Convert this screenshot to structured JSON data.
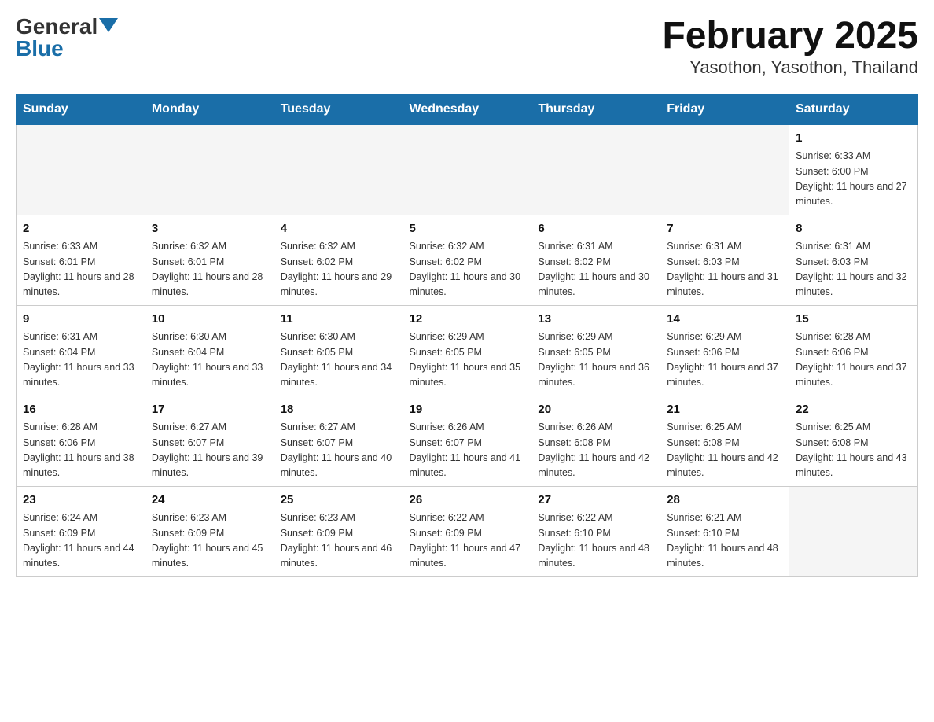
{
  "header": {
    "logo_general": "General",
    "logo_blue": "Blue",
    "title": "February 2025",
    "subtitle": "Yasothon, Yasothon, Thailand"
  },
  "days_of_week": [
    "Sunday",
    "Monday",
    "Tuesday",
    "Wednesday",
    "Thursday",
    "Friday",
    "Saturday"
  ],
  "weeks": [
    [
      {
        "day": "",
        "info": ""
      },
      {
        "day": "",
        "info": ""
      },
      {
        "day": "",
        "info": ""
      },
      {
        "day": "",
        "info": ""
      },
      {
        "day": "",
        "info": ""
      },
      {
        "day": "",
        "info": ""
      },
      {
        "day": "1",
        "info": "Sunrise: 6:33 AM\nSunset: 6:00 PM\nDaylight: 11 hours and 27 minutes."
      }
    ],
    [
      {
        "day": "2",
        "info": "Sunrise: 6:33 AM\nSunset: 6:01 PM\nDaylight: 11 hours and 28 minutes."
      },
      {
        "day": "3",
        "info": "Sunrise: 6:32 AM\nSunset: 6:01 PM\nDaylight: 11 hours and 28 minutes."
      },
      {
        "day": "4",
        "info": "Sunrise: 6:32 AM\nSunset: 6:02 PM\nDaylight: 11 hours and 29 minutes."
      },
      {
        "day": "5",
        "info": "Sunrise: 6:32 AM\nSunset: 6:02 PM\nDaylight: 11 hours and 30 minutes."
      },
      {
        "day": "6",
        "info": "Sunrise: 6:31 AM\nSunset: 6:02 PM\nDaylight: 11 hours and 30 minutes."
      },
      {
        "day": "7",
        "info": "Sunrise: 6:31 AM\nSunset: 6:03 PM\nDaylight: 11 hours and 31 minutes."
      },
      {
        "day": "8",
        "info": "Sunrise: 6:31 AM\nSunset: 6:03 PM\nDaylight: 11 hours and 32 minutes."
      }
    ],
    [
      {
        "day": "9",
        "info": "Sunrise: 6:31 AM\nSunset: 6:04 PM\nDaylight: 11 hours and 33 minutes."
      },
      {
        "day": "10",
        "info": "Sunrise: 6:30 AM\nSunset: 6:04 PM\nDaylight: 11 hours and 33 minutes."
      },
      {
        "day": "11",
        "info": "Sunrise: 6:30 AM\nSunset: 6:05 PM\nDaylight: 11 hours and 34 minutes."
      },
      {
        "day": "12",
        "info": "Sunrise: 6:29 AM\nSunset: 6:05 PM\nDaylight: 11 hours and 35 minutes."
      },
      {
        "day": "13",
        "info": "Sunrise: 6:29 AM\nSunset: 6:05 PM\nDaylight: 11 hours and 36 minutes."
      },
      {
        "day": "14",
        "info": "Sunrise: 6:29 AM\nSunset: 6:06 PM\nDaylight: 11 hours and 37 minutes."
      },
      {
        "day": "15",
        "info": "Sunrise: 6:28 AM\nSunset: 6:06 PM\nDaylight: 11 hours and 37 minutes."
      }
    ],
    [
      {
        "day": "16",
        "info": "Sunrise: 6:28 AM\nSunset: 6:06 PM\nDaylight: 11 hours and 38 minutes."
      },
      {
        "day": "17",
        "info": "Sunrise: 6:27 AM\nSunset: 6:07 PM\nDaylight: 11 hours and 39 minutes."
      },
      {
        "day": "18",
        "info": "Sunrise: 6:27 AM\nSunset: 6:07 PM\nDaylight: 11 hours and 40 minutes."
      },
      {
        "day": "19",
        "info": "Sunrise: 6:26 AM\nSunset: 6:07 PM\nDaylight: 11 hours and 41 minutes."
      },
      {
        "day": "20",
        "info": "Sunrise: 6:26 AM\nSunset: 6:08 PM\nDaylight: 11 hours and 42 minutes."
      },
      {
        "day": "21",
        "info": "Sunrise: 6:25 AM\nSunset: 6:08 PM\nDaylight: 11 hours and 42 minutes."
      },
      {
        "day": "22",
        "info": "Sunrise: 6:25 AM\nSunset: 6:08 PM\nDaylight: 11 hours and 43 minutes."
      }
    ],
    [
      {
        "day": "23",
        "info": "Sunrise: 6:24 AM\nSunset: 6:09 PM\nDaylight: 11 hours and 44 minutes."
      },
      {
        "day": "24",
        "info": "Sunrise: 6:23 AM\nSunset: 6:09 PM\nDaylight: 11 hours and 45 minutes."
      },
      {
        "day": "25",
        "info": "Sunrise: 6:23 AM\nSunset: 6:09 PM\nDaylight: 11 hours and 46 minutes."
      },
      {
        "day": "26",
        "info": "Sunrise: 6:22 AM\nSunset: 6:09 PM\nDaylight: 11 hours and 47 minutes."
      },
      {
        "day": "27",
        "info": "Sunrise: 6:22 AM\nSunset: 6:10 PM\nDaylight: 11 hours and 48 minutes."
      },
      {
        "day": "28",
        "info": "Sunrise: 6:21 AM\nSunset: 6:10 PM\nDaylight: 11 hours and 48 minutes."
      },
      {
        "day": "",
        "info": ""
      }
    ]
  ]
}
